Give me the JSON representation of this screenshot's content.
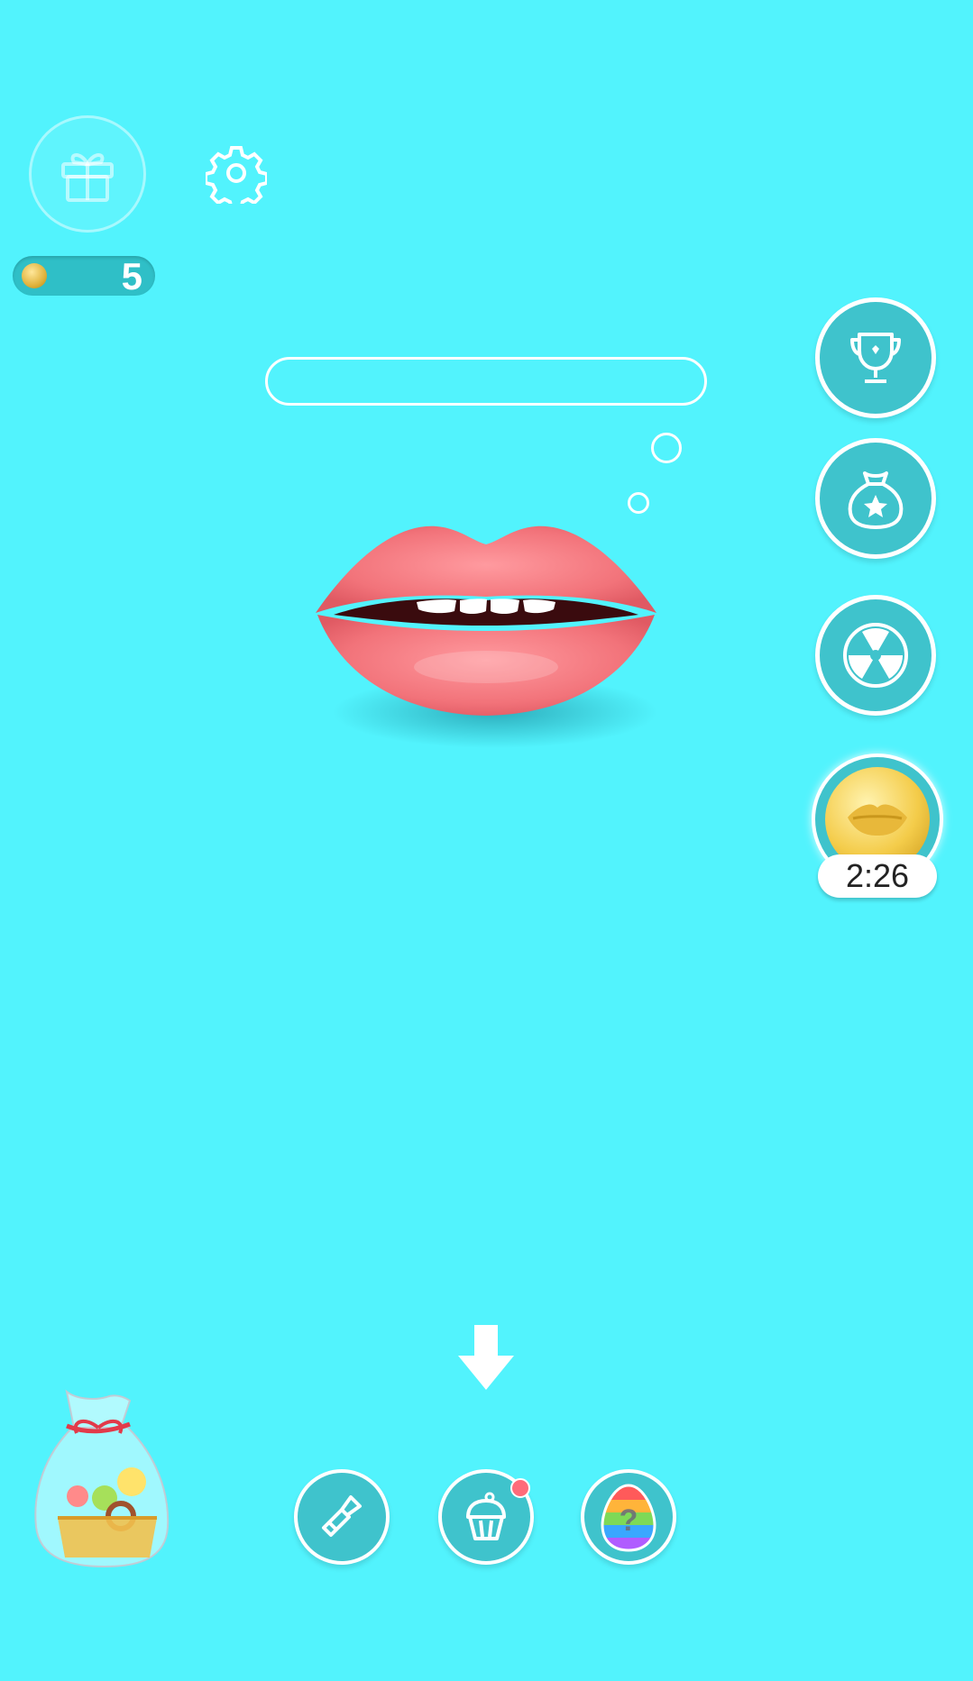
{
  "header": {
    "gift_icon": "gift-icon",
    "settings_icon": "gear-icon",
    "coins": {
      "icon": "coin-icon",
      "value": "5"
    }
  },
  "progress": {
    "fraction": 0.0
  },
  "sidebar": {
    "buttons": [
      {
        "icon": "trophy-icon"
      },
      {
        "icon": "star-bag-icon"
      },
      {
        "icon": "radiation-icon"
      },
      {
        "icon": "gold-lips-coin-icon"
      }
    ],
    "timer": "2:26"
  },
  "bottom_bar": {
    "arrow_icon": "arrow-down-icon",
    "tabs": [
      {
        "icon": "lipstick-icon"
      },
      {
        "icon": "cupcake-icon",
        "badge": true
      },
      {
        "icon": "mystery-egg-icon"
      }
    ],
    "bag_icon": "candy-bag-icon"
  },
  "colors": {
    "background": "#52f3fd",
    "button_fill": "#3fc3cc",
    "lips": "#f2737a",
    "badge": "#ff6b7a"
  }
}
